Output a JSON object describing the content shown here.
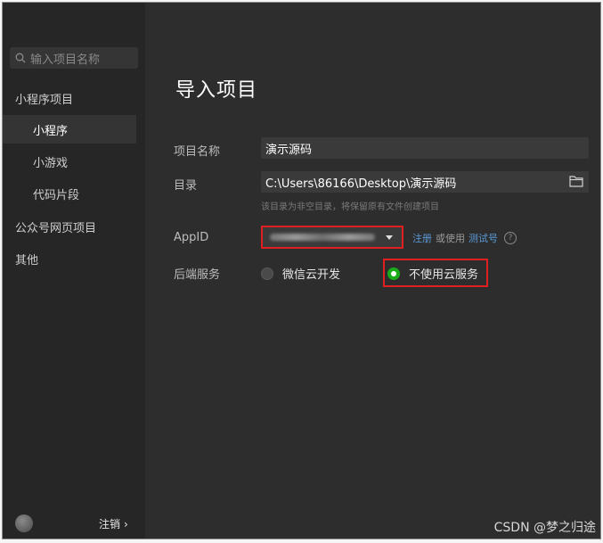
{
  "search": {
    "placeholder": "输入项目名称"
  },
  "sidebar": {
    "group1": "小程序项目",
    "items": [
      {
        "label": "小程序",
        "active": true
      },
      {
        "label": "小游戏",
        "active": false
      },
      {
        "label": "代码片段",
        "active": false
      }
    ],
    "group2": "公众号网页项目",
    "group3": "其他",
    "logout": "注销",
    "logout_chevron": "›"
  },
  "main": {
    "title": "导入项目",
    "name_label": "项目名称",
    "name_value": "演示源码",
    "dir_label": "目录",
    "dir_value": "C:\\Users\\86166\\Desktop\\演示源码",
    "dir_hint": "该目录为非空目录，将保留原有文件创建项目",
    "appid_label": "AppID",
    "register_link": "注册",
    "or_use": "或使用",
    "test_link": "测试号",
    "help_icon": "?",
    "backend_label": "后端服务",
    "option_cloud": "微信云开发",
    "option_no_cloud": "不使用云服务"
  },
  "colors": {
    "accent_green": "#1aad19",
    "highlight_red": "#e02020",
    "link_blue": "#5a9bd8"
  },
  "watermark": "CSDN @梦之归途"
}
